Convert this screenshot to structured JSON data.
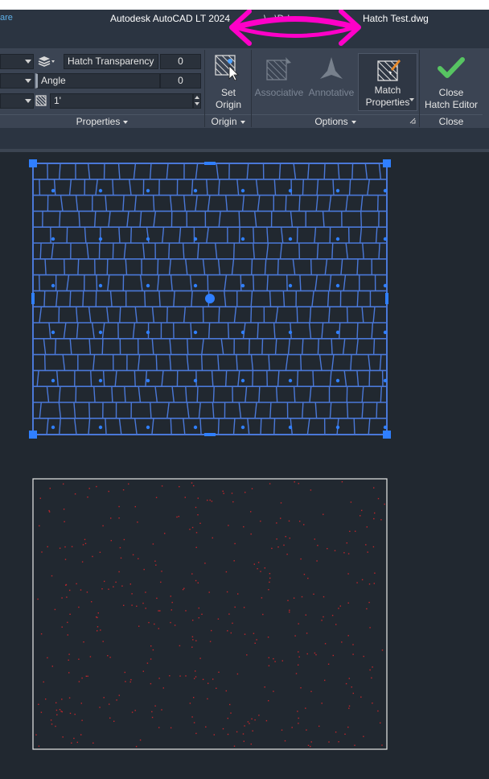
{
  "titlebar": {
    "share_label": "are",
    "app_title": "Autodesk AutoCAD LT 2024",
    "path_fragment": "...\\...\\Dd...",
    "file_name": "Hatch Test.dwg",
    "annotation_color": "#ff00c8"
  },
  "ribbon": {
    "properties": {
      "transparency_label": "Hatch Transparency",
      "transparency_value": "0",
      "angle_label": "Angle",
      "angle_value": "0",
      "scale_value": "1'",
      "panel_title": "Properties"
    },
    "origin": {
      "set_origin_label_1": "Set",
      "set_origin_label_2": "Origin",
      "panel_title": "Origin"
    },
    "options": {
      "associative_label": "Associative",
      "annotative_label": "Annotative",
      "match_label_1": "Match",
      "match_label_2": "Properties",
      "panel_title": "Options"
    },
    "close": {
      "close_label_1": "Close",
      "close_label_2": "Hatch Editor",
      "panel_title": "Close"
    }
  },
  "drawing": {
    "selection_color": "#2f7fff",
    "hatch_line_color": "#4a78d8",
    "boundary_color": "#e8e8e8",
    "speckle_color": "#c0262c"
  }
}
